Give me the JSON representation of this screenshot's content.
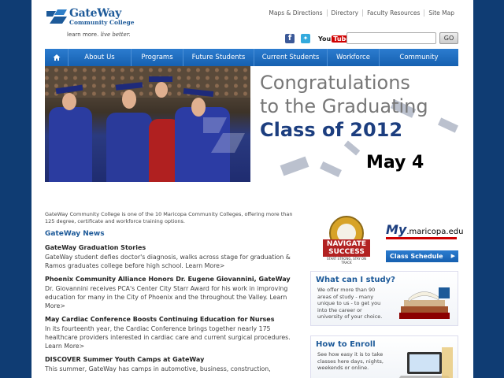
{
  "header": {
    "logo_name": "GateWay",
    "logo_sub": "Community College",
    "tagline_plain": "learn more.",
    "tagline_italic": "live better.",
    "top_links": [
      "Maps & Directions",
      "Directory",
      "Faculty Resources",
      "Site Map"
    ],
    "social": {
      "youtube": "You",
      "youtube_tube": "Tube"
    },
    "search": {
      "placeholder": "",
      "button": "GO"
    }
  },
  "nav": [
    "About Us",
    "Programs",
    "Future Students",
    "Current Students",
    "Workforce",
    "Community"
  ],
  "hero": {
    "line1": "Congratulations",
    "line2": "to the Graduating",
    "line3": "Class of 2012",
    "date": "May 4"
  },
  "main": {
    "intro": "GateWay Community College is one of the 10 Maricopa Community Colleges, offering more than 125 degree, certificate and workforce training options.",
    "news_heading": "GateWay News",
    "news": [
      {
        "title": "GateWay Graduation Stories",
        "body": "GateWay student defies doctor's diagnosis, walks across stage for graduation & Ramos graduates college before high school. Learn More>"
      },
      {
        "title": "Phoenix Community Alliance Honors Dr. Eugene Giovannini, GateWay",
        "body": "Dr. Giovannini receives PCA's Center City Starr Award for his work in improving education for many in the City of Phoenix and the throughout the Valley. Learn More>"
      },
      {
        "title": "May Cardiac Conference Boosts Continuing Education for Nurses",
        "body": "In its fourteenth year, the Cardiac Conference brings together nearly 175 healthcare providers interested in cardiac care and current surgical procedures. Learn More>"
      },
      {
        "title": "DISCOVER Summer Youth Camps at GateWay",
        "body": "This summer, GateWay has camps in automotive, business, construction,"
      }
    ]
  },
  "sidebar": {
    "badge_line1": "NAVIGATE",
    "badge_line2": "SUCCESS",
    "badge_sub": "START STRONG, STAY ON TRACK",
    "my_prefix": "My",
    "my_domain": ".maricopa.edu",
    "class_schedule": "Class Schedule",
    "study_title": "What can I study?",
    "study_body": "We offer more than 90 areas of study - many unique to us - to get you into the career or university of your choice.",
    "enroll_title": "How to Enroll",
    "enroll_body": "See how easy it is to take classes here days, nights, weekends or online."
  },
  "colors": {
    "frame": "#0f3c73",
    "nav": "#1f6fc2",
    "heading": "#1d5a99",
    "hero_dark": "#1c3e7f"
  }
}
